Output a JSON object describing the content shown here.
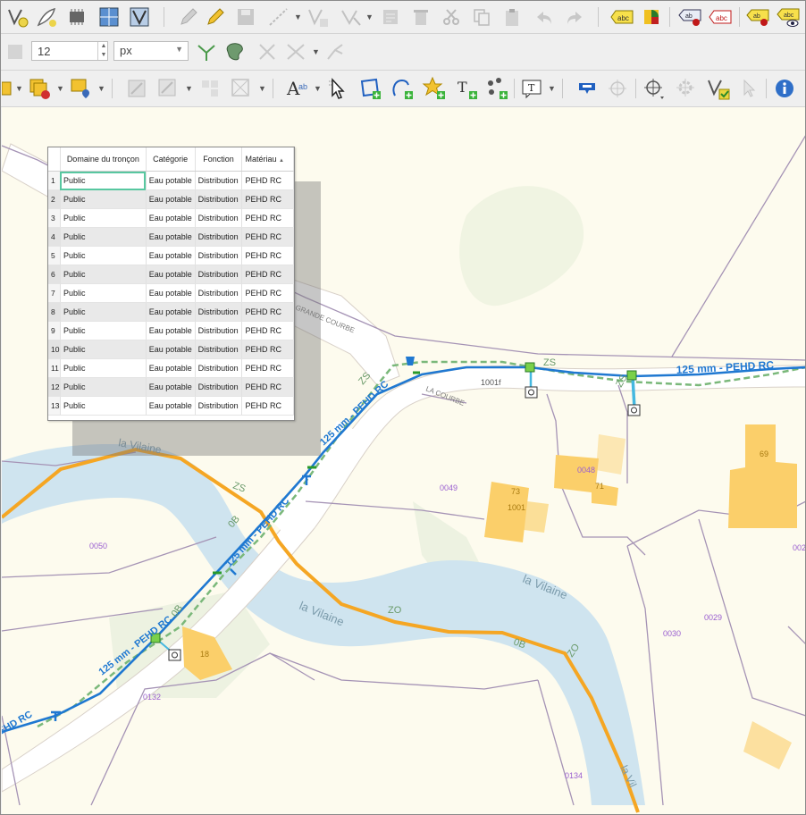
{
  "toolbar": {
    "size_value": "12",
    "size_unit": "px"
  },
  "attribute_table": {
    "columns": [
      "Domaine du tronçon",
      "Catégorie",
      "Fonction",
      "Matériau"
    ],
    "sort_indicator": "▲",
    "rows": [
      {
        "n": "1",
        "domaine": "Public",
        "categorie": "Eau potable",
        "fonction": "Distribution",
        "materiau": "PEHD RC"
      },
      {
        "n": "2",
        "domaine": "Public",
        "categorie": "Eau potable",
        "fonction": "Distribution",
        "materiau": "PEHD RC"
      },
      {
        "n": "3",
        "domaine": "Public",
        "categorie": "Eau potable",
        "fonction": "Distribution",
        "materiau": "PEHD RC"
      },
      {
        "n": "4",
        "domaine": "Public",
        "categorie": "Eau potable",
        "fonction": "Distribution",
        "materiau": "PEHD RC"
      },
      {
        "n": "5",
        "domaine": "Public",
        "categorie": "Eau potable",
        "fonction": "Distribution",
        "materiau": "PEHD RC"
      },
      {
        "n": "6",
        "domaine": "Public",
        "categorie": "Eau potable",
        "fonction": "Distribution",
        "materiau": "PEHD RC"
      },
      {
        "n": "7",
        "domaine": "Public",
        "categorie": "Eau potable",
        "fonction": "Distribution",
        "materiau": "PEHD RC"
      },
      {
        "n": "8",
        "domaine": "Public",
        "categorie": "Eau potable",
        "fonction": "Distribution",
        "materiau": "PEHD RC"
      },
      {
        "n": "9",
        "domaine": "Public",
        "categorie": "Eau potable",
        "fonction": "Distribution",
        "materiau": "PEHD RC"
      },
      {
        "n": "10",
        "domaine": "Public",
        "categorie": "Eau potable",
        "fonction": "Distribution",
        "materiau": "PEHD RC"
      },
      {
        "n": "11",
        "domaine": "Public",
        "categorie": "Eau potable",
        "fonction": "Distribution",
        "materiau": "PEHD RC"
      },
      {
        "n": "12",
        "domaine": "Public",
        "categorie": "Eau potable",
        "fonction": "Distribution",
        "materiau": "PEHD RC"
      },
      {
        "n": "13",
        "domaine": "Public",
        "categorie": "Eau potable",
        "fonction": "Distribution",
        "materiau": "PEHD RC"
      }
    ]
  },
  "map": {
    "pipe_label": "125 mm - PEHD RC",
    "pipe_label_partial": "PEHD RC",
    "river_name": "la Vilaine",
    "river_name_partial": "la Vil",
    "place_grande_courbe": "GRANDE COURBE",
    "place_la_courbe": "LA COURBE",
    "zone_zs": "ZS",
    "zone_zo": "ZO",
    "zone_0b": "0B",
    "parcel_1001f": "1001f",
    "parcel_0049": "0049",
    "parcel_0050": "0050",
    "parcel_0132": "0132",
    "parcel_0134": "0134",
    "parcel_0030": "0030",
    "parcel_0029": "0029",
    "parcel_0048": "0048",
    "parcel_002": "002",
    "building_71": "71",
    "building_73": "73",
    "building_1001": "1001",
    "building_69": "69",
    "building_18": "18",
    "colors": {
      "pipe": "#1f78d1",
      "branch": "#45b8e0",
      "river": "#cfe4ef",
      "road": "#ffffff",
      "orange_line": "#f5a623",
      "green_dashed": "#7ab87a",
      "building": "#fbcf6a",
      "parcel_line": "#a593b5",
      "parcel_text": "#9a5fd0"
    }
  }
}
